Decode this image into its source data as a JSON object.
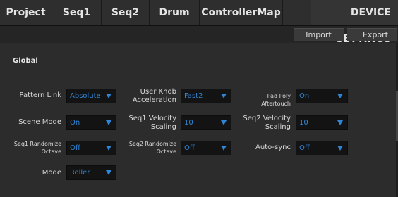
{
  "tabs": [
    {
      "label": "Project"
    },
    {
      "label": "Seq1"
    },
    {
      "label": "Seq2"
    },
    {
      "label": "Drum"
    },
    {
      "label": "ControllerMap"
    },
    {
      "label": ""
    },
    {
      "label": "DEVICE SETTINGS"
    }
  ],
  "toolbar": {
    "import_label": "Import",
    "export_label": "Export"
  },
  "section": {
    "title": "Global"
  },
  "settings": {
    "pattern_link": {
      "label": "Pattern Link",
      "value": "Absolute"
    },
    "user_knob_accel": {
      "label_line1": "User Knob",
      "label_line2": "Acceleration",
      "value": "Fast2"
    },
    "pad_poly_aftertouch": {
      "label": "Pad Poly Aftertouch",
      "value": "On"
    },
    "scene_mode": {
      "label": "Scene Mode",
      "value": "On"
    },
    "seq1_velocity_scaling": {
      "label_line1": "Seq1 Velocity",
      "label_line2": "Scaling",
      "value": "10"
    },
    "seq2_velocity_scaling": {
      "label_line1": "Seq2 Velocity",
      "label_line2": "Scaling",
      "value": "10"
    },
    "seq1_randomize_octave": {
      "label_line1": "Seq1 Randomize",
      "label_line2": "Octave",
      "value": "Off"
    },
    "seq2_randomize_octave": {
      "label_line1": "Seq2 Randomize",
      "label_line2": "Octave",
      "value": "Off"
    },
    "auto_sync": {
      "label": "Auto-sync",
      "value": "Off"
    },
    "mode": {
      "label": "Mode",
      "value": "Roller"
    }
  },
  "colors": {
    "accent": "#2f86d6",
    "background": "#2c2c2c"
  },
  "icons": {
    "dropdown": "chevron-down-icon"
  }
}
